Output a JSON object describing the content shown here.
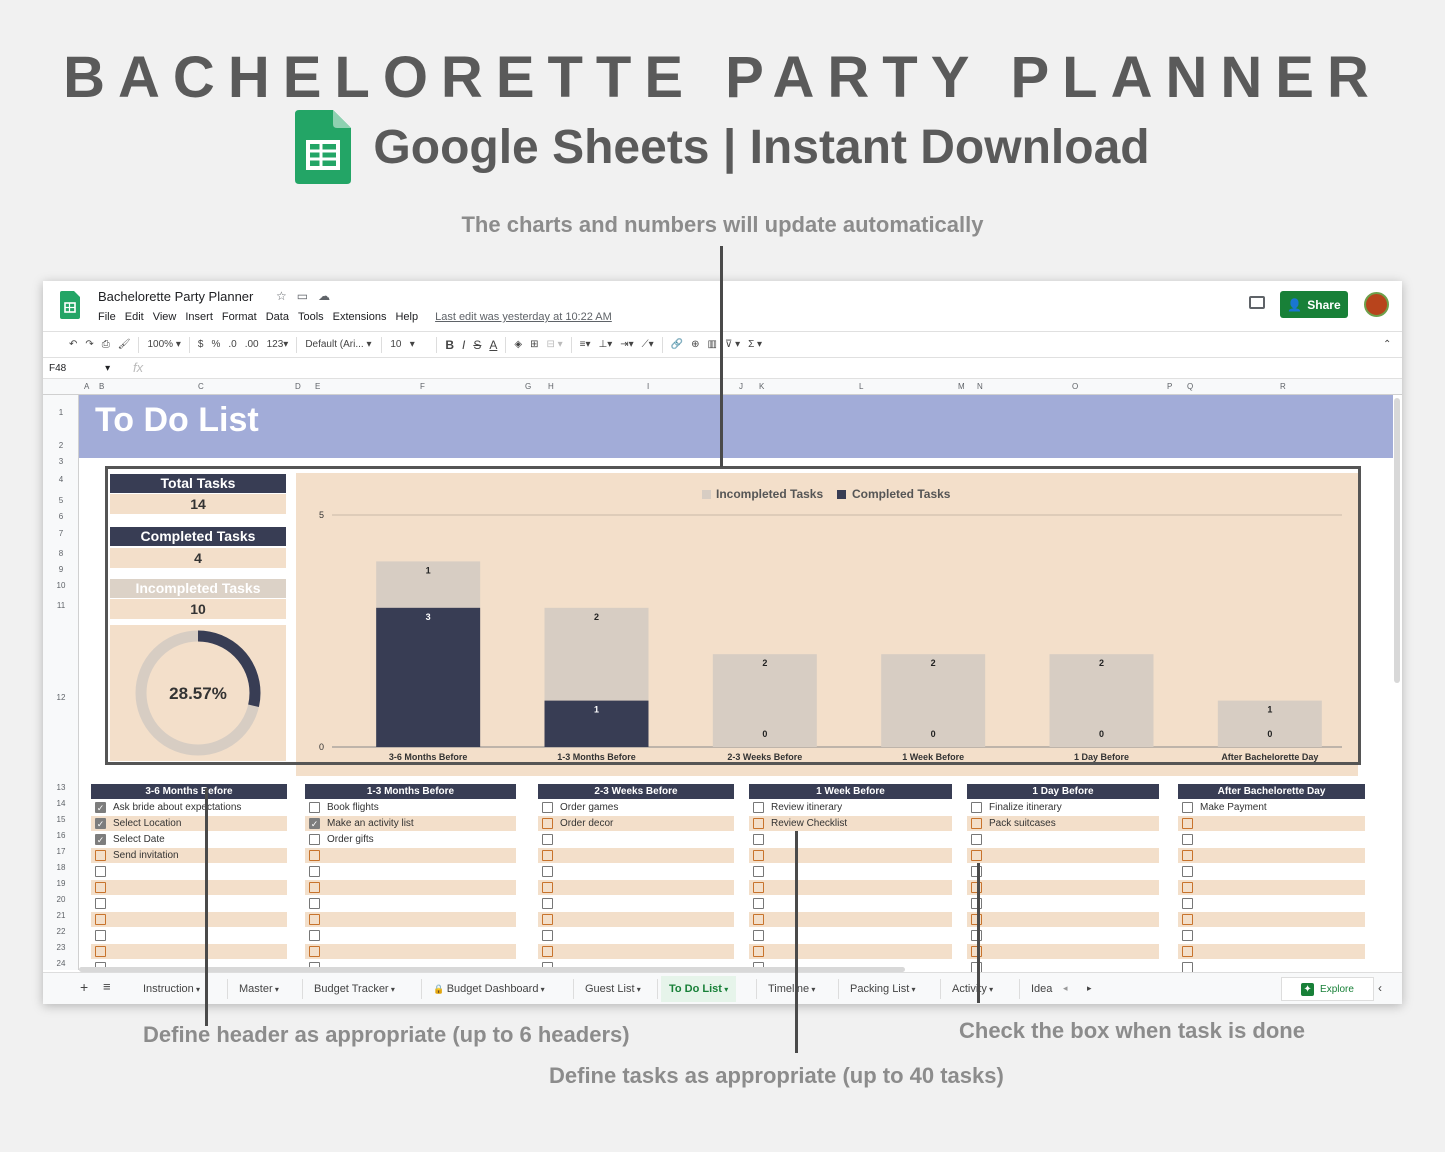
{
  "hero": {
    "title": "BACHELORETTE PARTY PLANNER",
    "subtitle": "Google Sheets | Instant Download"
  },
  "annotations": {
    "top": "The charts and numbers will update automatically",
    "header": "Define header as appropriate (up to 6 headers)",
    "checkbox": "Check the box when task is done",
    "tasks": "Define tasks as appropriate (up to 40 tasks)"
  },
  "app": {
    "doc_title": "Bachelorette Party Planner",
    "menu": [
      "File",
      "Edit",
      "View",
      "Insert",
      "Format",
      "Data",
      "Tools",
      "Extensions",
      "Help"
    ],
    "last_edit": "Last edit was yesterday at 10:22 AM",
    "share_label": "Share",
    "toolbar": {
      "zoom": "100%",
      "currency": "$",
      "percent": "%",
      "dec_less": ".0",
      "dec_more": ".00",
      "format_more": "123",
      "font": "Default (Ari...",
      "font_size": "10"
    },
    "cell_ref": "F48",
    "columns": [
      "A",
      "B",
      "C",
      "D",
      "E",
      "F",
      "G",
      "H",
      "I",
      "J",
      "K",
      "L",
      "M",
      "N",
      "O",
      "P",
      "Q",
      "R"
    ],
    "rows": [
      "1",
      "2",
      "3",
      "4",
      "5",
      "6",
      "7",
      "8",
      "9",
      "10",
      "11",
      "12",
      "13",
      "14",
      "15",
      "16",
      "17",
      "18",
      "19",
      "20",
      "21",
      "22",
      "23",
      "24"
    ]
  },
  "sheet": {
    "banner_title": "To Do List",
    "kpis": {
      "total_label": "Total Tasks",
      "total_value": "14",
      "completed_label": "Completed Tasks",
      "completed_value": "4",
      "incompleted_label": "Incompleted Tasks",
      "incompleted_value": "10"
    },
    "donut": {
      "percent_label": "28.57%",
      "fraction": 0.2857
    },
    "colors": {
      "dark": "#383d54",
      "light": "#d7cdc3",
      "peach": "#f3dfca",
      "banner": "#a2acd8",
      "checkbox_orange": "#c8732c"
    },
    "groups": [
      {
        "header": "3-6 Months Before",
        "tasks": [
          {
            "label": "Ask bride about expectations",
            "checked": true
          },
          {
            "label": "Select Location",
            "checked": true
          },
          {
            "label": "Select Date",
            "checked": true
          },
          {
            "label": "Send invitation",
            "checked": false
          }
        ]
      },
      {
        "header": "1-3 Months Before",
        "tasks": [
          {
            "label": "Book flights",
            "checked": false
          },
          {
            "label": "Make an activity list",
            "checked": true
          },
          {
            "label": "Order gifts",
            "checked": false
          }
        ]
      },
      {
        "header": "2-3 Weeks Before",
        "tasks": [
          {
            "label": "Order games",
            "checked": false
          },
          {
            "label": "Order decor",
            "checked": false
          }
        ]
      },
      {
        "header": "1 Week Before",
        "tasks": [
          {
            "label": "Review itinerary",
            "checked": false
          },
          {
            "label": "Review Checklist",
            "checked": false
          }
        ]
      },
      {
        "header": "1 Day Before",
        "tasks": [
          {
            "label": "Finalize itinerary",
            "checked": false
          },
          {
            "label": "Pack suitcases",
            "checked": false
          }
        ]
      },
      {
        "header": "After Bachelorette Day",
        "tasks": [
          {
            "label": "Make Payment",
            "checked": false
          }
        ]
      }
    ],
    "tabs": [
      "Instruction",
      "Master",
      "Budget Tracker",
      "Budget Dashboard",
      "Guest List",
      "To Do List",
      "Timeline",
      "Packing List",
      "Activity",
      "Idea"
    ],
    "active_tab": "To Do List",
    "explore_label": "Explore"
  },
  "chart_data": {
    "type": "bar",
    "stacked": true,
    "categories": [
      "3-6 Months Before",
      "1-3 Months Before",
      "2-3 Weeks Before",
      "1 Week Before",
      "1 Day Before",
      "After Bachelorette Day"
    ],
    "series": [
      {
        "name": "Completed Tasks",
        "values": [
          3,
          1,
          0,
          0,
          0,
          0
        ],
        "color": "#383d54"
      },
      {
        "name": "Incompleted Tasks",
        "values": [
          1,
          2,
          2,
          2,
          2,
          1
        ],
        "color": "#d7cdc3"
      }
    ],
    "ylim": [
      0,
      5
    ],
    "yticks": [
      "0",
      "5"
    ],
    "legend": "top-center"
  }
}
